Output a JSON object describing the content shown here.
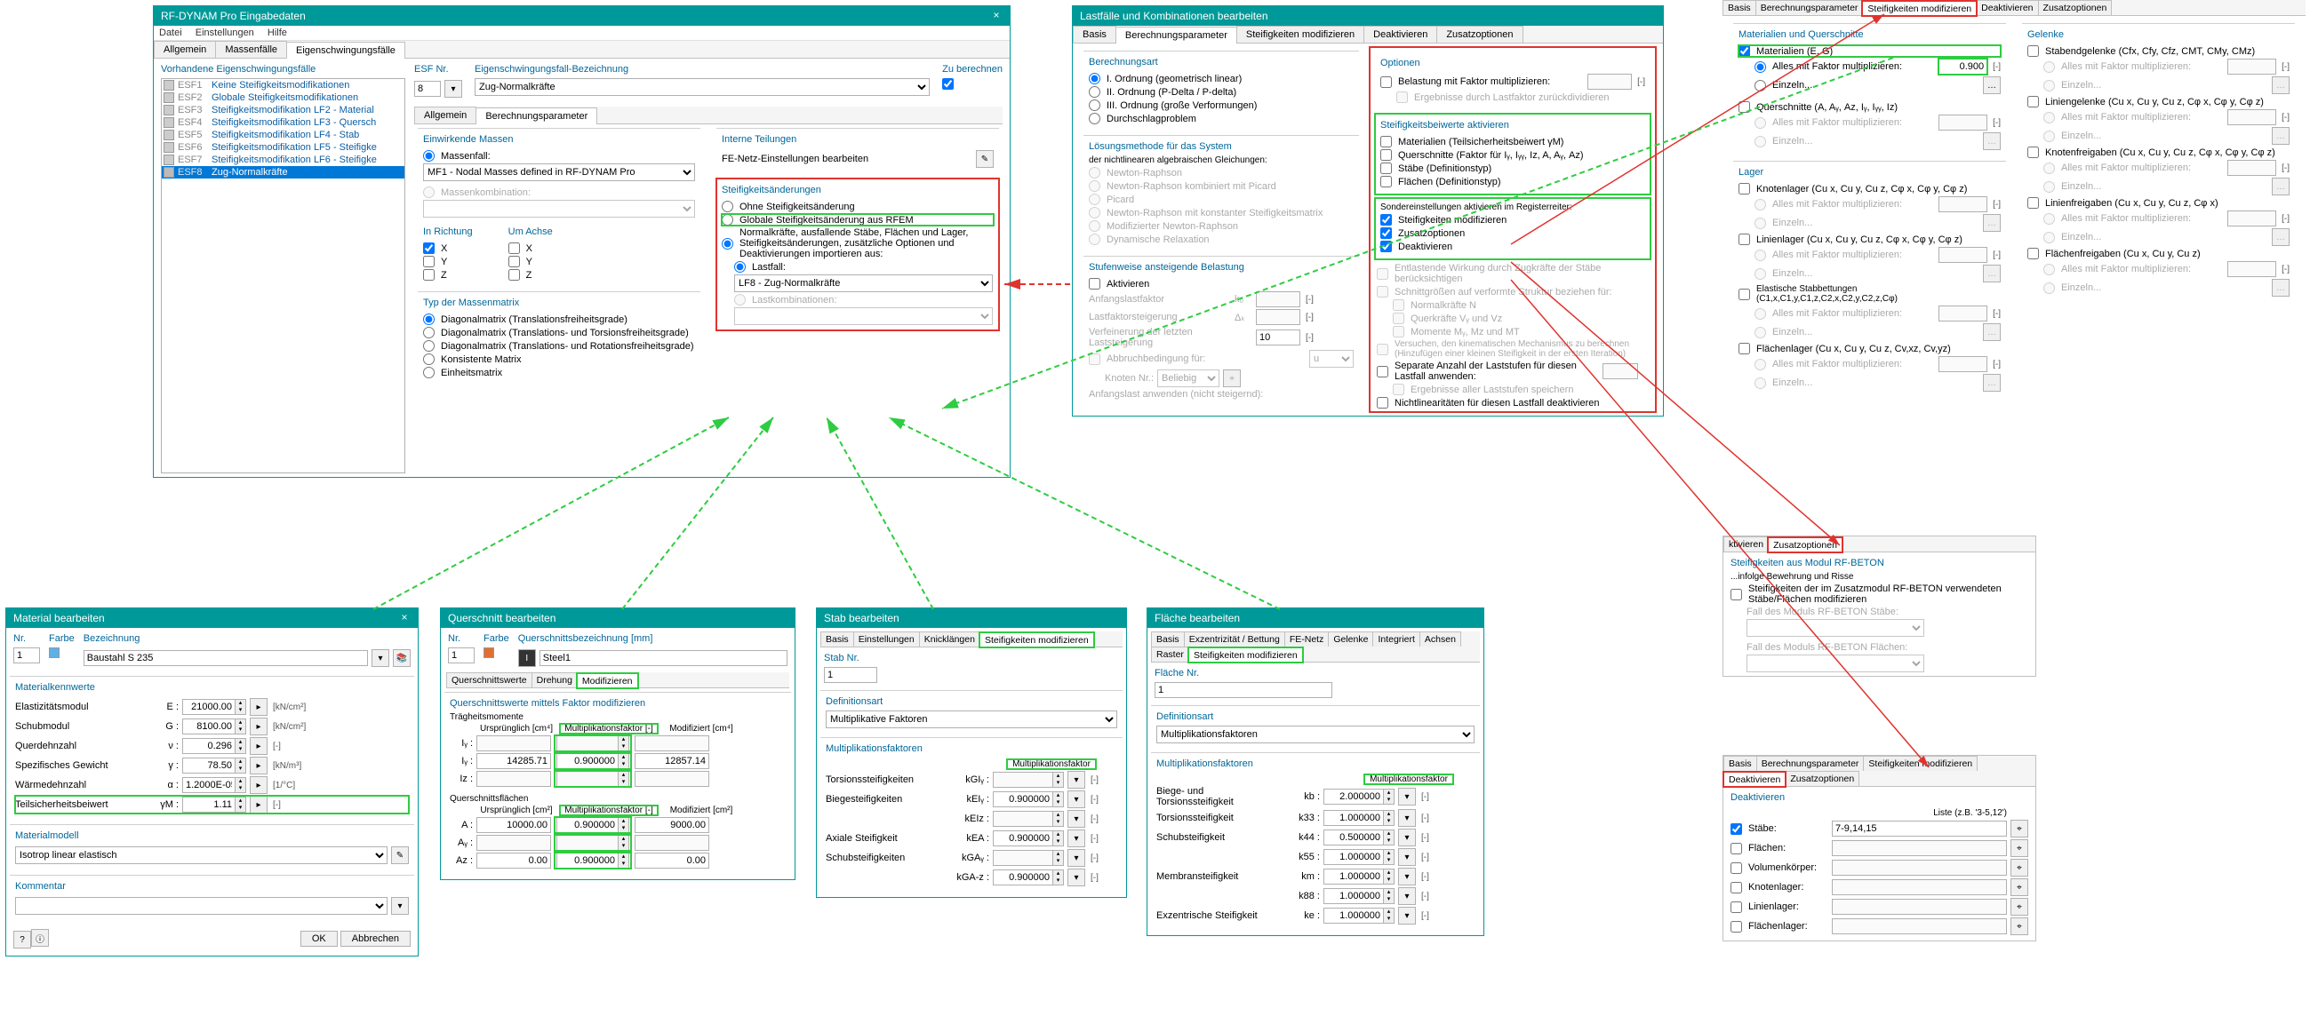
{
  "input": {
    "title": "RF-DYNAM Pro Eingabedaten",
    "menu": [
      "Datei",
      "Einstellungen",
      "Hilfe"
    ],
    "tabs": [
      "Allgemein",
      "Massenfälle",
      "Eigenschwingungsfälle"
    ],
    "activeTab": 2,
    "listHeader": "Vorhandene Eigenschwingungsfälle",
    "list": [
      {
        "code": "ESF1",
        "text": "Keine Steifigkeitsmodifikationen"
      },
      {
        "code": "ESF2",
        "text": "Globale Steifigkeitsmodifikationen"
      },
      {
        "code": "ESF3",
        "text": "Steifigkeitsmodifikation LF2 - Material"
      },
      {
        "code": "ESF4",
        "text": "Steifigkeitsmodifikation LF3 - Quersch"
      },
      {
        "code": "ESF5",
        "text": "Steifigkeitsmodifikation LF4 - Stab"
      },
      {
        "code": "ESF6",
        "text": "Steifigkeitsmodifikation LF5 - Steifigke"
      },
      {
        "code": "ESF7",
        "text": "Steifigkeitsmodifikation LF6 - Steifigke"
      },
      {
        "code": "ESF8",
        "text": "Zug-Normalkräfte"
      }
    ],
    "esfNrLabel": "ESF Nr.",
    "esfNr": "8",
    "bezLabel": "Eigenschwingungsfall-Bezeichnung",
    "bez": "Zug-Normalkräfte",
    "zuBerechnen": "Zu berechnen",
    "subTabs": [
      "Allgemein",
      "Berechnungsparameter"
    ],
    "subActive": 1,
    "massenHeader": "Einwirkende Massen",
    "massenfall": "Massenfall:",
    "massenfallVal": "MF1 - Nodal Masses defined in RF-DYNAM Pro",
    "massenkomb": "Massenkombination:",
    "richtungHeader": "In Richtung",
    "achseHeader": "Um Achse",
    "axes": [
      "X",
      "Y",
      "Z"
    ],
    "typHeader": "Typ der Massenmatrix",
    "typOpts": [
      "Diagonalmatrix (Translationsfreiheitsgrade)",
      "Diagonalmatrix (Translations- und Torsionsfreiheitsgrade)",
      "Diagonalmatrix (Translations- und Rotationsfreiheitsgrade)",
      "Konsistente Matrix",
      "Einheitsmatrix"
    ],
    "teilHeader": "Interne Teilungen",
    "feNetz": "FE-Netz-Einstellungen bearbeiten",
    "steifHeader": "Steifigkeitsänderungen",
    "steifOpts": [
      "Ohne Steifigkeitsänderung",
      "Globale Steifigkeitsänderung aus RFEM",
      "Normalkräfte, ausfallende Stäbe, Flächen und Lager, Steifigkeitsänderungen, zusätzliche Optionen und Deaktivierungen importieren aus:"
    ],
    "lastfall": "Lastfall:",
    "lastfallVal": "LF8 - Zug-Normalkräfte",
    "lastkomb": "Lastkombinationen:"
  },
  "lf": {
    "title": "Lastfälle und Kombinationen bearbeiten",
    "tabs": [
      "Basis",
      "Berechnungsparameter",
      "Steifigkeiten modifizieren",
      "Deaktivieren",
      "Zusatzoptionen"
    ],
    "activeTab": 1,
    "berechHeader": "Berechnungsart",
    "berechOpts": [
      "I. Ordnung (geometrisch linear)",
      "II. Ordnung (P-Delta / P-delta)",
      "III. Ordnung (große Verformungen)",
      "Durchschlagproblem"
    ],
    "loesHeader": "Lösungsmethode für das System",
    "loesSub": "der nichtlinearen algebraischen Gleichungen:",
    "loesOpts": [
      "Newton-Raphson",
      "Newton-Raphson kombiniert mit Picard",
      "Picard",
      "Newton-Raphson mit konstanter Steifigkeitsmatrix",
      "Modifizierter Newton-Raphson",
      "Dynamische Relaxation"
    ],
    "stufHeader": "Stufenweise ansteigende Belastung",
    "aktivieren": "Aktivieren",
    "stufItems": [
      {
        "l": "Anfangslastfaktor",
        "s": "k₀",
        "v": "",
        "u": "[-]"
      },
      {
        "l": "Lastfaktorsteigerung",
        "s": "Δₖ",
        "v": "",
        "u": "[-]"
      },
      {
        "l": "Verfeinerung der letzten Laststeigerung",
        "s": "",
        "v": "10",
        "u": "[-]"
      }
    ],
    "abbruch": "Abbruchbedingung für:",
    "abbruchSym": "u",
    "knotenNr": "Knoten Nr.:",
    "beliebig": "Beliebig",
    "anfangslast": "Anfangslast anwenden (nicht steigernd):",
    "optHeader": "Optionen",
    "optBelastung": "Belastung mit Faktor multiplizieren:",
    "optErgLF": "Ergebnisse durch Lastfaktor zurückdividieren",
    "steifAktHeader": "Steifigkeitsbeiwerte aktivieren",
    "steifAktOpts": [
      "Materialien (Teilsicherheitsbeiwert γM)",
      "Querschnitte (Faktor für Iᵧ, Iᵧᵧ, Iz, A, Aᵧ, Az)",
      "Stäbe (Definitionstyp)",
      "Flächen (Definitionstyp)"
    ],
    "sonderHeader": "Sondereinstellungen aktivieren im Registerreiter:",
    "sonderOpts": [
      "Steifigkeiten modifizieren",
      "Zusatzoptionen",
      "Deaktivieren"
    ],
    "entlast": "Entlastende Wirkung durch Zugkräfte der Stäbe berücksichtigen",
    "schnitt": "Schnittgrößen auf verformte Struktur beziehen für:",
    "schnittOpts": [
      "Normalkräfte N",
      "Querkräfte Vᵧ und Vz",
      "Momente Mᵧ, Mz und MT"
    ],
    "versuchen": "Versuchen, den kinematischen Mechanismus zu berechnen (Hinzufügen einer kleinen Steifigkeit in der ersten Iteration)",
    "separat": "Separate Anzahl der Laststufen für diesen Lastfall anwenden:",
    "ergAll": "Ergebnisse aller Laststufen speichern",
    "nichtlin": "Nichtlinearitäten für diesen Lastfall deaktivieren"
  },
  "mat": {
    "title": "Material bearbeiten",
    "nr": "Nr.",
    "nrVal": "1",
    "farbe": "Farbe",
    "bez": "Bezeichnung",
    "bezVal": "Baustahl S 235",
    "kwHeader": "Materialkennwerte",
    "rows": [
      {
        "l": "Elastizitätsmodul",
        "s": "E :",
        "v": "21000.00",
        "u": "[kN/cm²]"
      },
      {
        "l": "Schubmodul",
        "s": "G :",
        "v": "8100.00",
        "u": "[kN/cm²]"
      },
      {
        "l": "Querdehnzahl",
        "s": "ν :",
        "v": "0.296",
        "u": "[-]"
      },
      {
        "l": "Spezifisches Gewicht",
        "s": "γ :",
        "v": "78.50",
        "u": "[kN/m³]"
      },
      {
        "l": "Wärmedehnzahl",
        "s": "α :",
        "v": "1.2000E-05",
        "u": "[1/°C]"
      },
      {
        "l": "Teilsicherheitsbeiwert",
        "s": "γM :",
        "v": "1.11",
        "u": "[-]",
        "hl": true
      }
    ],
    "modellHeader": "Materialmodell",
    "modellVal": "Isotrop linear elastisch",
    "kommentar": "Kommentar",
    "ok": "OK",
    "cancel": "Abbrechen"
  },
  "qs": {
    "title": "Querschnitt bearbeiten",
    "nr": "Nr.",
    "nrVal": "1",
    "farbe": "Farbe",
    "bez": "Querschnittsbezeichnung [mm]",
    "bezVal": "Steel1",
    "tabs": [
      "Querschnittswerte",
      "Drehung",
      "Modifizieren"
    ],
    "secHeader": "Querschnittswerte mittels Faktor modifizieren",
    "traeg": "Trägheitsmomente",
    "flaechen": "Querschnittsflächen",
    "colHeaders": [
      "Ursprünglich [cm⁴]",
      "Multiplikationsfaktor [-]",
      "Modifiziert [cm⁴]"
    ],
    "colHeadersA": [
      "Ursprünglich [cm²]",
      "Multiplikationsfaktor [-]",
      "Modifiziert [cm²]"
    ],
    "rows": [
      {
        "s": "Iᵧ :",
        "o": "",
        "f": "",
        "m": ""
      },
      {
        "s": "Iᵧ :",
        "o": "14285.71",
        "f": "0.900000",
        "m": "12857.14"
      },
      {
        "s": "Iz :",
        "o": "",
        "f": "",
        "m": ""
      }
    ],
    "arows": [
      {
        "s": "A :",
        "o": "10000.00",
        "f": "0.900000",
        "m": "9000.00"
      },
      {
        "s": "Aᵧ :",
        "o": "",
        "f": "",
        "m": ""
      },
      {
        "s": "Az :",
        "o": "0.00",
        "f": "0.900000",
        "m": "0.00"
      }
    ]
  },
  "stab": {
    "title": "Stab bearbeiten",
    "tabs": [
      "Basis",
      "Einstellungen",
      "Knicklängen",
      "Steifigkeiten modifizieren"
    ],
    "nrLabel": "Stab Nr.",
    "nr": "1",
    "defHeader": "Definitionsart",
    "defVal": "Multiplikative Faktoren",
    "mulHeader": "Multiplikationsfaktoren",
    "factorCol": "Multiplikationsfaktor",
    "rows": [
      {
        "l": "Torsionssteifigkeiten",
        "s": "kGIᵧ :",
        "v": "",
        "u": "[-]"
      },
      {
        "l": "Biegesteifigkeiten",
        "s": "kEIᵧ :",
        "v": "0.900000",
        "u": "[-]"
      },
      {
        "l": "",
        "s": "kEIz :",
        "v": "",
        "u": "[-]"
      },
      {
        "l": "Axiale Steifigkeit",
        "s": "kEA :",
        "v": "0.900000",
        "u": "[-]"
      },
      {
        "l": "Schubsteifigkeiten",
        "s": "kGAᵧ :",
        "v": "",
        "u": "[-]"
      },
      {
        "l": "",
        "s": "kGA-z :",
        "v": "0.900000",
        "u": "[-]"
      }
    ]
  },
  "fl": {
    "title": "Fläche bearbeiten",
    "tabs": [
      "Basis",
      "Exzentrizität / Bettung",
      "FE-Netz",
      "Gelenke",
      "Integriert",
      "Achsen",
      "Raster",
      "Steifigkeiten modifizieren"
    ],
    "nrLabel": "Fläche Nr.",
    "nr": "1",
    "defHeader": "Definitionsart",
    "defVal": "Multiplikationsfaktoren",
    "mulHeader": "Multiplikationsfaktoren",
    "factorCol": "Multiplikationsfaktor",
    "rows": [
      {
        "l": "Biege- und Torsionssteifigkeit",
        "s": "kb :",
        "v": "2.000000",
        "u": "[-]"
      },
      {
        "l": "Torsionssteifigkeit",
        "s": "k33 :",
        "v": "1.000000",
        "u": "[-]"
      },
      {
        "l": "Schubsteifigkeit",
        "s": "k44 :",
        "v": "0.500000",
        "u": "[-]"
      },
      {
        "l": "",
        "s": "k55 :",
        "v": "1.000000",
        "u": "[-]"
      },
      {
        "l": "Membransteifigkeit",
        "s": "km :",
        "v": "1.000000",
        "u": "[-]"
      },
      {
        "l": "",
        "s": "k88 :",
        "v": "1.000000",
        "u": "[-]"
      },
      {
        "l": "Exzentrische Steifigkeit",
        "s": "ke :",
        "v": "1.000000",
        "u": "[-]"
      }
    ]
  },
  "steif": {
    "tabs": [
      "Basis",
      "Berechnungsparameter",
      "Steifigkeiten modifizieren",
      "Deaktivieren",
      "Zusatzoptionen"
    ],
    "matHeader": "Materialien und Querschnitte",
    "matChk": "Materialien (E, G)",
    "allesFaktor": "Alles mit Faktor multiplizieren:",
    "einzeln": "Einzeln...",
    "qsChk": "Querschnitte (A, Aᵧ, Az, Iᵧ, Iᵧᵧ, Iz)",
    "matFactor": "0.900",
    "lagerHeader": "Lager",
    "knotenlager": "Knotenlager (Cu x, Cu y, Cu z, Cφ x, Cφ y, Cφ z)",
    "linienlager": "Linienlager (Cu x, Cu y, Cu z, Cφ x, Cφ y, Cφ z)",
    "elStab": "Elastische Stabbettungen (C1,x,C1,y,C1,z,C2,x,C2,y,C2,z,Cφ)",
    "flLager": "Flächenlager (Cu x, Cu y, Cu z, Cv,xz, Cv,yz)",
    "gelHeader": "Gelenke",
    "stabgel": "Stabendgelenke (Cfx, Cfy, Cfz, CMT, CMy, CMz)",
    "liniengel": "Liniengelenke (Cu x, Cu y, Cu z, Cφ x, Cφ y, Cφ z)",
    "knotenfrei": "Knotenfreigaben (Cu x, Cu y, Cu z, Cφ x, Cφ y, Cφ z)",
    "linienfrei": "Linienfreigaben (Cu x, Cu y, Cu z, Cφ x)",
    "flfrei": "Flächenfreigaben (Cu x, Cu y, Cu z)"
  },
  "zusatz": {
    "tabs": [
      "ktivieren",
      "Zusatzoptionen"
    ],
    "hdr": "Steifigkeiten aus Modul RF-BETON",
    "line": "...infolge Bewehrung und Risse",
    "chk": "Steifigkeiten der im Zusatzmodul RF-BETON verwendeten Stäbe/Flächen modifizieren",
    "fallStab": "Fall des Moduls RF-BETON Stäbe:",
    "fallFl": "Fall des Moduls RF-BETON Flächen:"
  },
  "deakt": {
    "tabs": [
      "Basis",
      "Berechnungsparameter",
      "Steifigkeiten modifizieren",
      "Deaktivieren",
      "Zusatzoptionen"
    ],
    "hdr": "Deaktivieren",
    "listePlaceholder": "Liste (z.B. '3-5,12')",
    "rows": [
      {
        "l": "Stäbe:",
        "v": "7-9,14,15",
        "chk": true
      },
      {
        "l": "Flächen:",
        "v": "",
        "chk": false
      },
      {
        "l": "Volumenkörper:",
        "v": "",
        "chk": false
      },
      {
        "l": "Knotenlager:",
        "v": "",
        "chk": false
      },
      {
        "l": "Linienlager:",
        "v": "",
        "chk": false
      },
      {
        "l": "Flächenlager:",
        "v": "",
        "chk": false
      }
    ]
  }
}
